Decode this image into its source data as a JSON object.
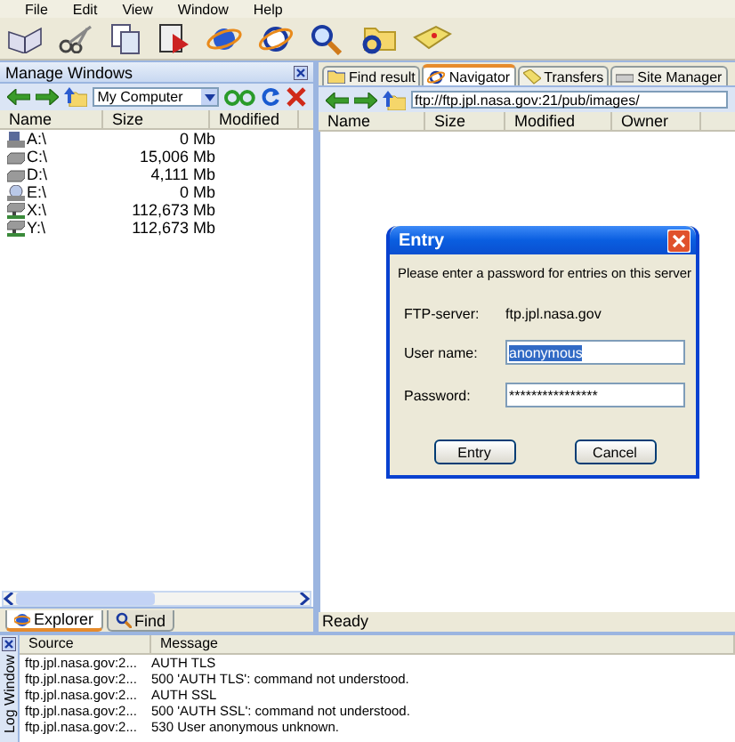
{
  "menu": [
    "File",
    "Edit",
    "View",
    "Window",
    "Help"
  ],
  "left_panel": {
    "title": "Manage Windows",
    "location": "My Computer",
    "columns": [
      "Name",
      "Size",
      "Modified"
    ],
    "rows": [
      {
        "name": "A:\\",
        "size": "0 Mb",
        "kind": "floppy"
      },
      {
        "name": "C:\\",
        "size": "15,006 Mb",
        "kind": "disk"
      },
      {
        "name": "D:\\",
        "size": "4,111 Mb",
        "kind": "disk"
      },
      {
        "name": "E:\\",
        "size": "0 Mb",
        "kind": "cdrom"
      },
      {
        "name": "X:\\",
        "size": "112,673 Mb",
        "kind": "network"
      },
      {
        "name": "Y:\\",
        "size": "112,673 Mb",
        "kind": "network"
      }
    ],
    "tabs": [
      {
        "label": "Explorer",
        "selected": true
      },
      {
        "label": "Find",
        "selected": false
      }
    ]
  },
  "right_panel": {
    "tabs": [
      {
        "label": "Find result",
        "selected": false
      },
      {
        "label": "Navigator",
        "selected": true
      },
      {
        "label": "Transfers",
        "selected": false
      },
      {
        "label": "Site Manager",
        "selected": false
      }
    ],
    "address": "ftp://ftp.jpl.nasa.gov:21/pub/images/",
    "columns": [
      "Name",
      "Size",
      "Modified",
      "Owner"
    ]
  },
  "status_bar": "Ready",
  "log_window": {
    "title": "Log Window",
    "columns": [
      "Source",
      "Message"
    ],
    "rows": [
      {
        "source": "ftp.jpl.nasa.gov:2...",
        "message": "AUTH TLS"
      },
      {
        "source": "ftp.jpl.nasa.gov:2...",
        "message": "500 'AUTH TLS': command not understood."
      },
      {
        "source": "ftp.jpl.nasa.gov:2...",
        "message": "AUTH SSL"
      },
      {
        "source": "ftp.jpl.nasa.gov:2...",
        "message": "500 'AUTH SSL': command not understood."
      },
      {
        "source": "ftp.jpl.nasa.gov:2...",
        "message": "530 User anonymous unknown."
      }
    ]
  },
  "dialog": {
    "title": "Entry",
    "prompt": "Please enter a password for entries on this server",
    "server_label": "FTP-server:",
    "server": "ftp.jpl.nasa.gov",
    "username_label": "User name:",
    "username": "anonymous",
    "password_label": "Password:",
    "password": "****************",
    "buttons": [
      "Entry",
      "Cancel"
    ]
  }
}
